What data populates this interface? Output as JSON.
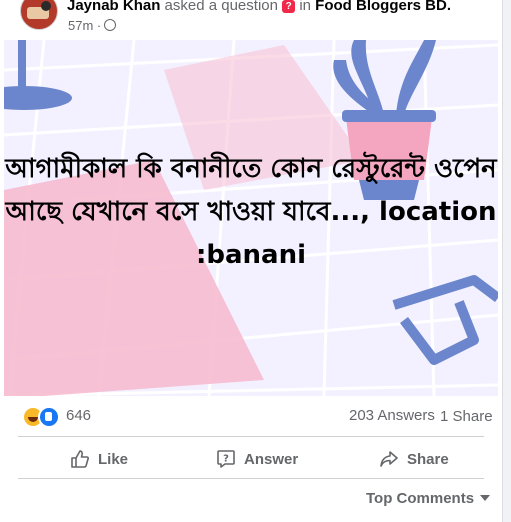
{
  "post": {
    "author": "Jaynab Khan",
    "action_text": "asked a question",
    "in_text": "in",
    "group": "Food Bloggers BD.",
    "time": "57m ·",
    "question_badge": "?",
    "body": "আগামীকাল কি বনানীতে কোন রেস্টুরেন্ট ওপেন আছে যেখানে বসে খাওয়া যাবে..., location :banani"
  },
  "stats": {
    "reactions_count": "646",
    "answers": "203 Answers",
    "shares": "1 Share",
    "reaction_icons": [
      "haha-icon",
      "like-icon"
    ]
  },
  "actions": {
    "like": "Like",
    "answer": "Answer",
    "share": "Share"
  },
  "comments": {
    "sort_label": "Top Comments"
  },
  "colors": {
    "background": "#f3f1ff",
    "grid_line": "#ffffff",
    "pink_block": "#f6b8cc",
    "illustration": "#6b86cc",
    "muted_text": "#65676b"
  }
}
